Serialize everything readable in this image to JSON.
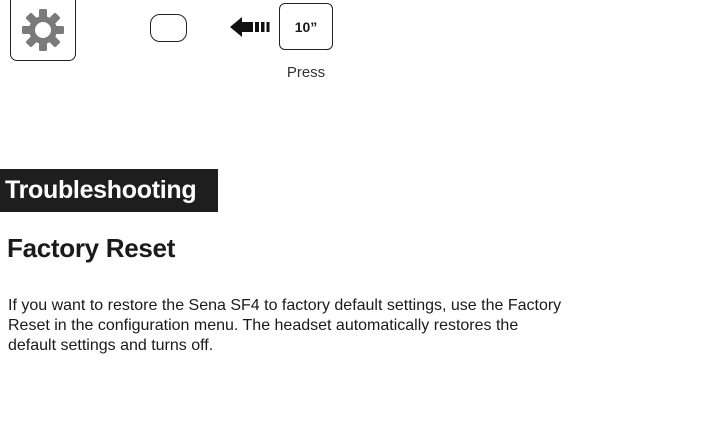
{
  "diagram": {
    "gear_icon": "gear-icon",
    "button_icon": "round-button-icon",
    "arrow_icon": "left-arrow-icon",
    "press_duration": "10”",
    "press_label": "Press"
  },
  "section": {
    "title": "Troubleshooting"
  },
  "subsection": {
    "title": "Factory Reset"
  },
  "body": {
    "lines": [
      "If you want to restore the Sena SF4 to factory default settings, use the Factory",
      "Reset in the configuration menu. The headset automatically restores the",
      "default settings and turns off."
    ]
  },
  "colors": {
    "header_bg": "#1e1e1e",
    "header_text": "#ffffff",
    "text": "#1a1a1a"
  }
}
